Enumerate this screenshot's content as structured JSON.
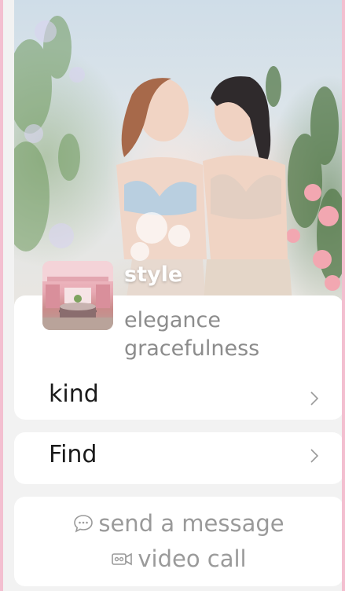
{
  "product": {
    "style_label": "style",
    "description_lines": [
      "elegance",
      "gracefulness"
    ]
  },
  "rows": {
    "kind_label": "kind",
    "find_label": "Find"
  },
  "contact": {
    "message_label": "send a message",
    "message_icon": "chat-bubble-icon",
    "video_label": "video call",
    "video_icon": "video-camera-icon"
  },
  "colors": {
    "frame_border": "#f3bfd0",
    "background": "#f2f2f2",
    "card": "#ffffff",
    "muted_text": "#8c8c8c",
    "primary_text": "#1a1a1a"
  }
}
